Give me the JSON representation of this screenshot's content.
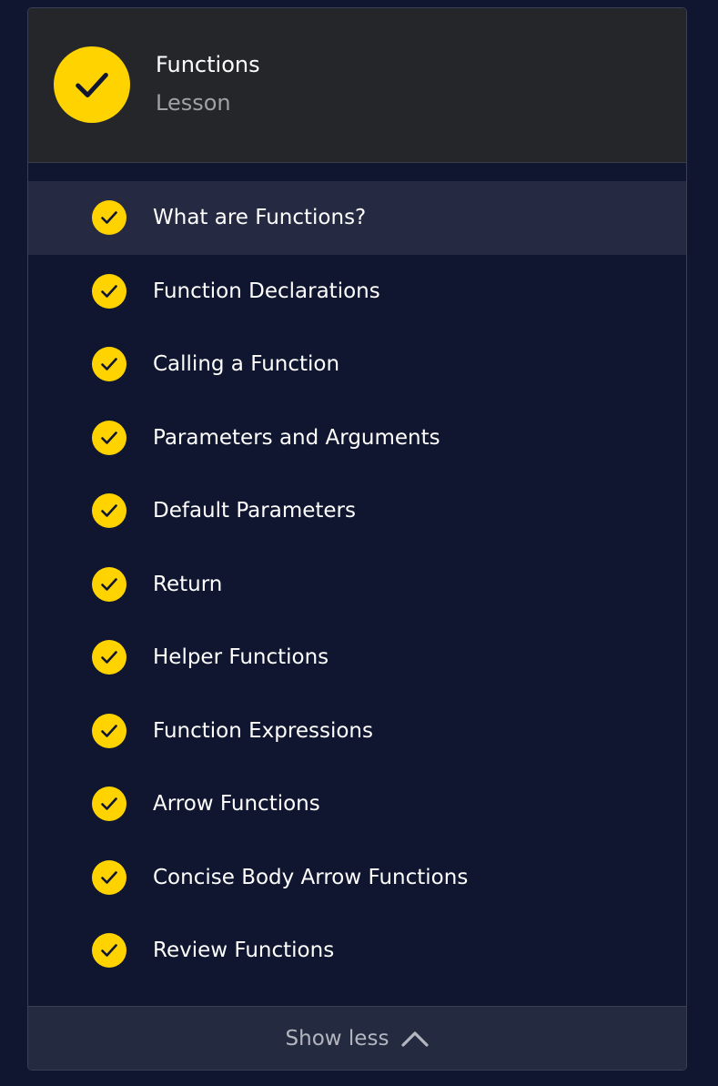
{
  "header": {
    "icon": "check-icon",
    "title": "Functions",
    "subtitle": "Lesson"
  },
  "items": [
    {
      "label": "What are Functions?",
      "status": "completed",
      "active": true
    },
    {
      "label": "Function Declarations",
      "status": "completed",
      "active": false
    },
    {
      "label": "Calling a Function",
      "status": "completed",
      "active": false
    },
    {
      "label": "Parameters and Arguments",
      "status": "completed",
      "active": false
    },
    {
      "label": "Default Parameters",
      "status": "completed",
      "active": false
    },
    {
      "label": "Return",
      "status": "completed",
      "active": false
    },
    {
      "label": "Helper Functions",
      "status": "completed",
      "active": false
    },
    {
      "label": "Function Expressions",
      "status": "completed",
      "active": false
    },
    {
      "label": "Arrow Functions",
      "status": "completed",
      "active": false
    },
    {
      "label": "Concise Body Arrow Functions",
      "status": "completed",
      "active": false
    },
    {
      "label": "Review Functions",
      "status": "completed",
      "active": false
    }
  ],
  "footer": {
    "label": "Show less",
    "icon": "chevron-up-icon"
  },
  "colors": {
    "background": "#10162f",
    "header_bg": "#252629",
    "active_row": "#252a42",
    "check_yellow": "#ffd300",
    "footer_bg": "#242a3f"
  }
}
